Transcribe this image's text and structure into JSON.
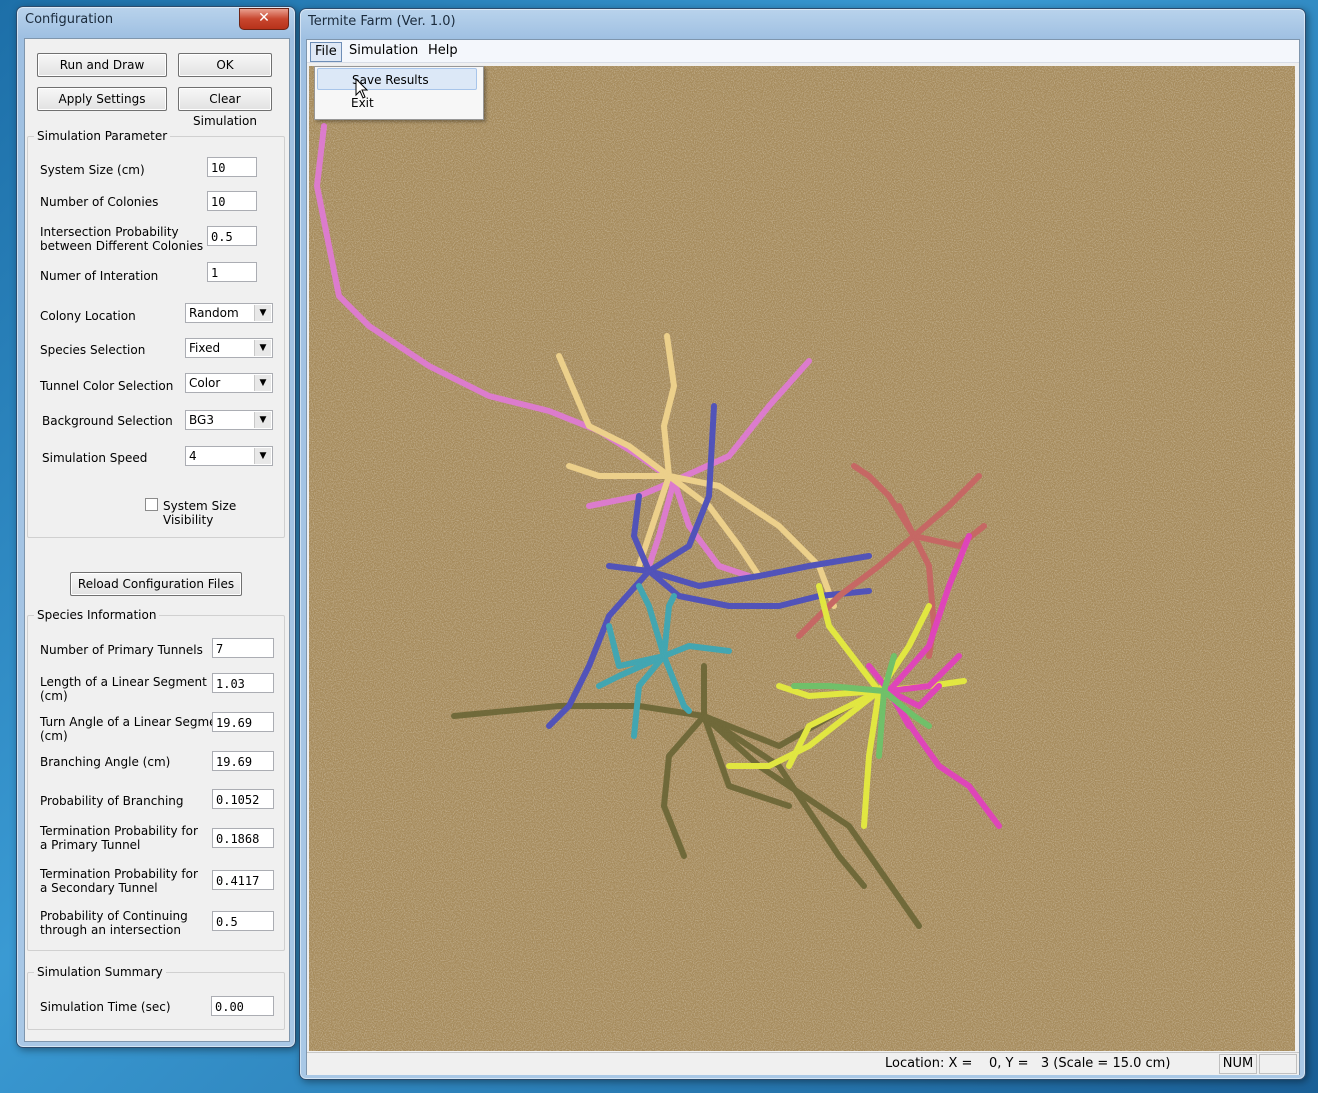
{
  "config_window": {
    "title": "Configuration",
    "close_glyph": "✕",
    "buttons": {
      "run_and_draw": "Run and Draw",
      "ok": "OK",
      "apply_settings": "Apply Settings",
      "clear_simulation": "Clear Simulation",
      "reload_config": "Reload Configuration Files"
    },
    "sim_params": {
      "group_label": "Simulation Parameter",
      "system_size_label": "System Size (cm)",
      "system_size_value": "10",
      "num_colonies_label": "Number of Colonies",
      "num_colonies_value": "10",
      "intersection_label_1": "Intersection Probability",
      "intersection_label_2": "between Different Colonies",
      "intersection_value": "0.5",
      "iterations_label": "Numer of Interation",
      "iterations_value": "1",
      "colony_location_label": "Colony Location",
      "colony_location_value": "Random",
      "species_selection_label": "Species Selection",
      "species_selection_value": "Fixed",
      "tunnel_color_label": "Tunnel Color Selection",
      "tunnel_color_value": "Color",
      "background_label": "Background Selection",
      "background_value": "BG3",
      "speed_label": "Simulation Speed",
      "speed_value": "4",
      "system_size_visibility_label": "System Size Visibility",
      "system_size_visibility_checked": false
    },
    "species_info": {
      "group_label": "Species Information",
      "primary_tunnels_label": "Number of Primary Tunnels",
      "primary_tunnels_value": "7",
      "segment_length_label_1": "Length of a Linear Segment",
      "segment_length_label_2": "(cm)",
      "segment_length_value": "1.03",
      "turn_angle_label_1": "Turn Angle of a Linear Segment",
      "turn_angle_label_2": "(cm)",
      "turn_angle_value": "19.69",
      "branching_angle_label": "Branching Angle (cm)",
      "branching_angle_value": "19.69",
      "prob_branching_label": "Probability of Branching",
      "prob_branching_value": "0.1052",
      "term_primary_label_1": "Termination Probability for",
      "term_primary_label_2": "a Primary Tunnel",
      "term_primary_value": "0.1868",
      "term_secondary_label_1": "Termination Probability for",
      "term_secondary_label_2": "a Secondary Tunnel",
      "term_secondary_value": "0.4117",
      "prob_continuing_label_1": "Probability of Continuing",
      "prob_continuing_label_2": "through an intersection",
      "prob_continuing_value": "0.5"
    },
    "summary": {
      "group_label": "Simulation Summary",
      "sim_time_label": "Simulation Time (sec)",
      "sim_time_value": "0.00"
    }
  },
  "main_window": {
    "title": "Termite Farm (Ver. 1.0)",
    "menu": [
      "File",
      "Simulation",
      "Help"
    ],
    "file_menu_items": [
      "Save Results",
      "Exit"
    ],
    "status_location": "Location: X =    0, Y =   3 (Scale = 15.0 cm)",
    "status_num": "NUM",
    "tunnel_colors": {
      "pink": "#e07ad6",
      "cream": "#f2d58e",
      "blue": "#4a4ec0",
      "red": "#c86464",
      "yellow": "#e6ee3e",
      "magenta": "#e33fc0",
      "green": "#6cc46a",
      "cyan": "#3aa8b8",
      "olive": "#6b6636"
    },
    "background_color": "#a68b5b"
  }
}
